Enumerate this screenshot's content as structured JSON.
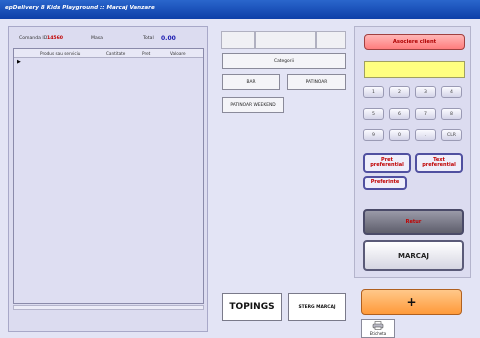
{
  "window": {
    "title": "epDelivery 8 Kids Playground :: Marcaj Vanzare"
  },
  "order": {
    "id_label": "Comanda ID",
    "id_value": "14560",
    "table_label": "Masa",
    "total_label": "Total",
    "total_value": "0.00"
  },
  "grid": {
    "columns": [
      "Produs sau serviciu",
      "Cantitate",
      "Pret",
      "Valoare"
    ],
    "marker": "▶"
  },
  "catalog": {
    "category_button": "Categorii",
    "products": [
      "BAR",
      "PATINOAR",
      "PATINOAR WEEKEND"
    ]
  },
  "bottom": {
    "topings": "TOPINGS",
    "sterg_marcaj": "STERG MARCAJ"
  },
  "right": {
    "asociere": "Asociere client",
    "keypad": [
      "1",
      "2",
      "3",
      "4",
      "5",
      "6",
      "7",
      "8",
      "9",
      "0",
      ".",
      "CLR"
    ],
    "pret_preferential": "Pret preferential",
    "text_preferential": "Text preferential",
    "preferinte": "Preferinte",
    "retur": "Retur",
    "marcaj": "MARCAJ",
    "plus": "+",
    "eticheta": "Eticheta"
  },
  "icons": {
    "eticheta": "printer-icon",
    "row_marker": "row-pointer-icon"
  }
}
